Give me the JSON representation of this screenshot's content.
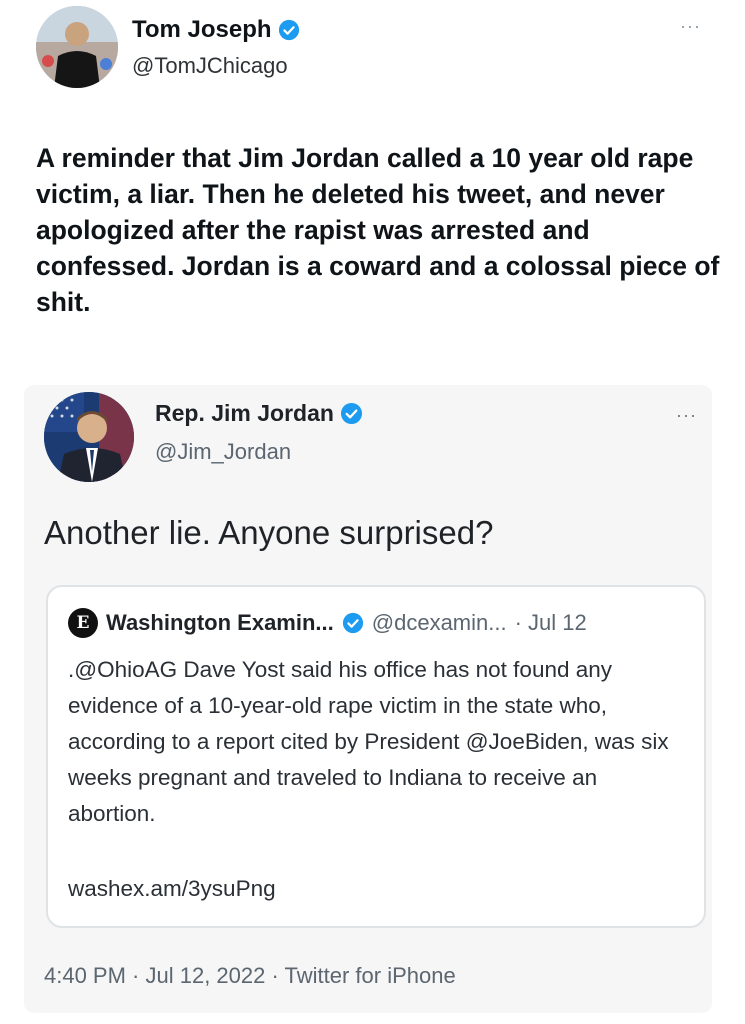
{
  "outer_tweet": {
    "author_name": "Tom Joseph",
    "author_handle": "@TomJChicago",
    "more_label": "···",
    "text": "A reminder that Jim Jordan called a 10 year old rape victim, a liar. Then he deleted his tweet, and never apologized after the rapist was arrested and confessed. Jordan is a coward and a colossal piece of shit."
  },
  "embedded_tweet": {
    "author_name": "Rep. Jim Jordan",
    "author_handle": "@Jim_Jordan",
    "more_label": "···",
    "text": "Another lie. Anyone surprised?",
    "quoted": {
      "logo_letter": "E",
      "author_name": "Washington Examin...",
      "author_handle": "@dcexamin...",
      "date": "· Jul 12",
      "text": ".@OhioAG Dave Yost said his office has not found any evidence of a 10-year-old rape victim in the state who, according to a report cited by President @JoeBiden, was six weeks pregnant and traveled to Indiana to receive an abortion.",
      "link": "washex.am/3ysuPng"
    },
    "meta": "4:40 PM · Jul 12, 2022 · Twitter for iPhone"
  },
  "colors": {
    "verified_blue": "#1d9bf0",
    "card_background": "#f6f6f6"
  },
  "icons": [
    "verified-badge-icon",
    "more-options-icon",
    "washington-examiner-logo-icon"
  ]
}
